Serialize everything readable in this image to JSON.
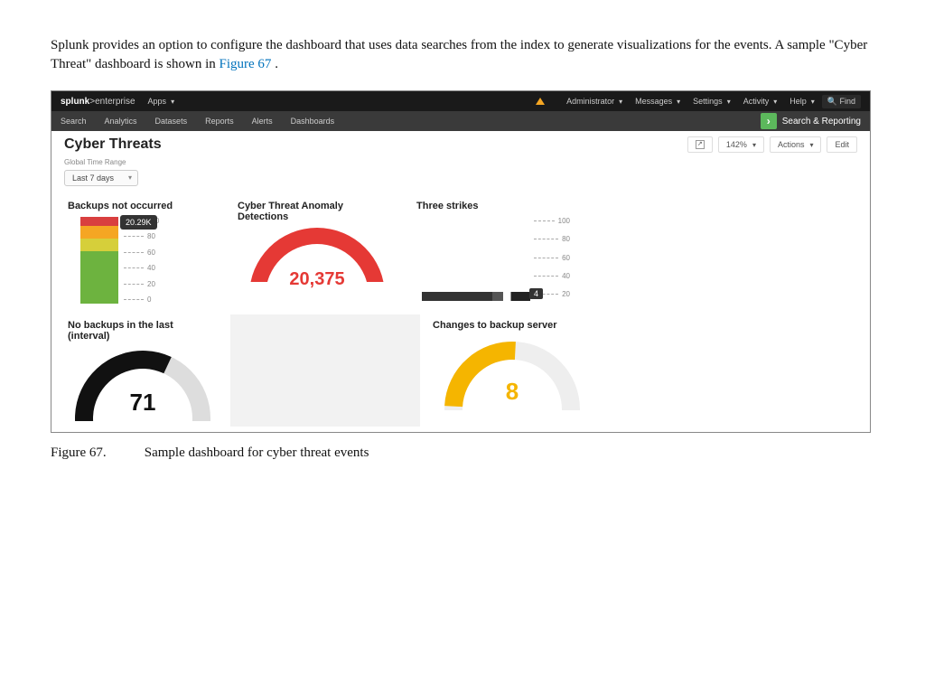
{
  "body_text_pre": "Splunk provides an option to configure the dashboard that uses data searches from the index to generate visualizations for the events. A sample \"Cyber Threat\" dashboard is shown in ",
  "body_figref": "Figure 67",
  "body_text_post": " .",
  "caption_label": "Figure 67.",
  "caption_text": "Sample dashboard for cyber threat events",
  "topbar": {
    "brand_a": "splunk",
    "brand_b": ">enterprise",
    "apps": "Apps",
    "admin": "Administrator",
    "messages": "Messages",
    "settings": "Settings",
    "activity": "Activity",
    "help": "Help",
    "find": "Find"
  },
  "subbar": {
    "items": [
      "Search",
      "Analytics",
      "Datasets",
      "Reports",
      "Alerts",
      "Dashboards"
    ],
    "app_label": "Search & Reporting"
  },
  "title": "Cyber Threats",
  "zoom": "142%",
  "actions": "Actions",
  "edit": "Edit",
  "filter_label": "Global Time Range",
  "filter_value": "Last 7 days",
  "panels": {
    "p1_title": "Backups not occurred",
    "p2_title": "Cyber Threat Anomaly Detections",
    "p3_title": "Three strikes",
    "p4_title": "No backups in the last (interval)",
    "p5_title": "Changes to backup server"
  },
  "chart_data": [
    {
      "type": "bar",
      "panel": "Backups not occurred",
      "ylim": [
        0,
        100
      ],
      "yticks": [
        0,
        20,
        40,
        60,
        80,
        100
      ],
      "stack": [
        {
          "color": "green",
          "value": 60
        },
        {
          "color": "yellow",
          "value": 15
        },
        {
          "color": "orange",
          "value": 15
        },
        {
          "color": "red",
          "value": 10
        }
      ],
      "tooltip_value": "20.29K"
    },
    {
      "type": "gauge",
      "panel": "Cyber Threat Anomaly Detections",
      "value": 20375,
      "display": "20,375",
      "color": "red"
    },
    {
      "type": "bar",
      "panel": "Three strikes",
      "ylim": [
        0,
        100
      ],
      "yticks": [
        20,
        40,
        60,
        80,
        100
      ],
      "value": 4,
      "display": "4"
    },
    {
      "type": "gauge",
      "panel": "No backups in the last (interval)",
      "value": 71,
      "display": "71",
      "color": "black"
    },
    {
      "type": "gauge",
      "panel": "Changes to backup server",
      "value": 8,
      "display": "8",
      "color": "yellow"
    }
  ]
}
